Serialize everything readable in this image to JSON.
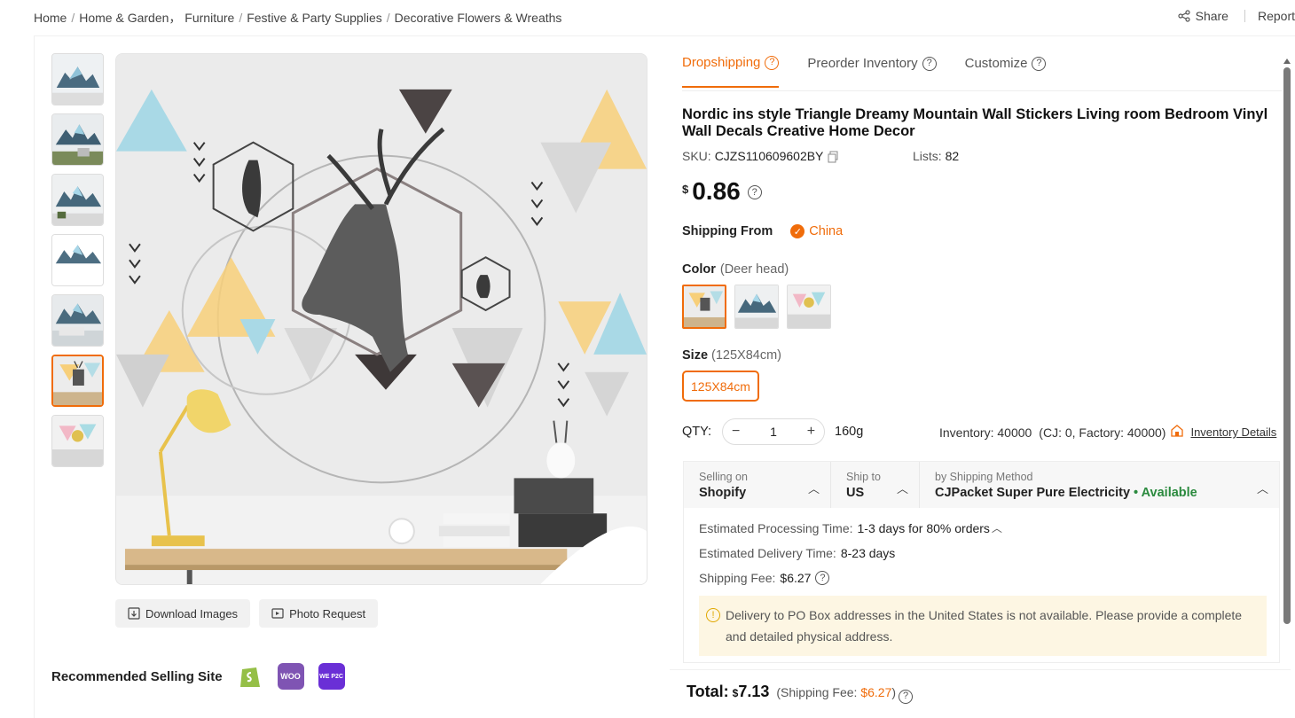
{
  "breadcrumb": {
    "items": [
      "Home",
      "Home & Garden， Furniture",
      "Festive & Party Supplies",
      "Decorative Flowers & Wreaths"
    ],
    "separator": "/"
  },
  "top_actions": {
    "share": "Share",
    "report": "Report"
  },
  "gallery": {
    "thumbnail_count": 7,
    "active_index": 5,
    "download_label": "Download Images",
    "photo_request_label": "Photo Request"
  },
  "recommended": {
    "label": "Recommended Selling Site",
    "sites": [
      {
        "name": "shopify-icon",
        "color": "#95bf47"
      },
      {
        "name": "woocommerce-icon",
        "text": "WOO",
        "color": "#7f54b3"
      },
      {
        "name": "wepro-icon",
        "text": "WE P2C",
        "color": "#6a2fd6"
      }
    ]
  },
  "tabs": [
    {
      "label": "Dropshipping",
      "active": true
    },
    {
      "label": "Preorder Inventory",
      "active": false
    },
    {
      "label": "Customize",
      "active": false
    }
  ],
  "product": {
    "title": "Nordic ins style Triangle Dreamy Mountain Wall Stickers Living room Bedroom Vinyl Wall Decals Creative Home Decor",
    "sku_label": "SKU:",
    "sku": "CJZS110609602BY",
    "lists_label": "Lists:",
    "lists": "82",
    "currency": "$",
    "price": "0.86"
  },
  "shipping_from": {
    "label": "Shipping From",
    "value": "China"
  },
  "color": {
    "label": "Color",
    "selected": "(Deer head)",
    "option_count": 3,
    "active_index": 0
  },
  "size": {
    "label": "Size",
    "selected": "(125X84cm)",
    "option": "125X84cm"
  },
  "qty": {
    "label": "QTY:",
    "value": "1",
    "weight": "160g",
    "minus": "−",
    "plus": "+"
  },
  "inventory": {
    "text": "Inventory: 40000",
    "breakdown": "(CJ: 0, Factory: 40000)",
    "link": "Inventory Details"
  },
  "shipping": {
    "selling_on_label": "Selling on",
    "selling_on": "Shopify",
    "ship_to_label": "Ship to",
    "ship_to": "US",
    "method_label": "by Shipping Method",
    "method": "CJPacket Super Pure Electricity",
    "availability": "• Available",
    "processing_label": "Estimated Processing Time:",
    "processing": "1-3 days for 80% orders",
    "delivery_label": "Estimated Delivery Time:",
    "delivery": "8-23 days",
    "fee_label": "Shipping Fee:",
    "fee": "$6.27",
    "warning": "Delivery to PO Box addresses in the United States is not available. Please provide a complete and detailed physical address."
  },
  "total": {
    "label": "Total:",
    "currency": "$",
    "amount": "7.13",
    "fee_prefix": "(Shipping Fee:",
    "fee": "$6.27",
    "fee_suffix": ")"
  },
  "colors": {
    "accent": "#f06c0a",
    "available": "#2b8a3e",
    "warning_bg": "#fdf6e3"
  }
}
